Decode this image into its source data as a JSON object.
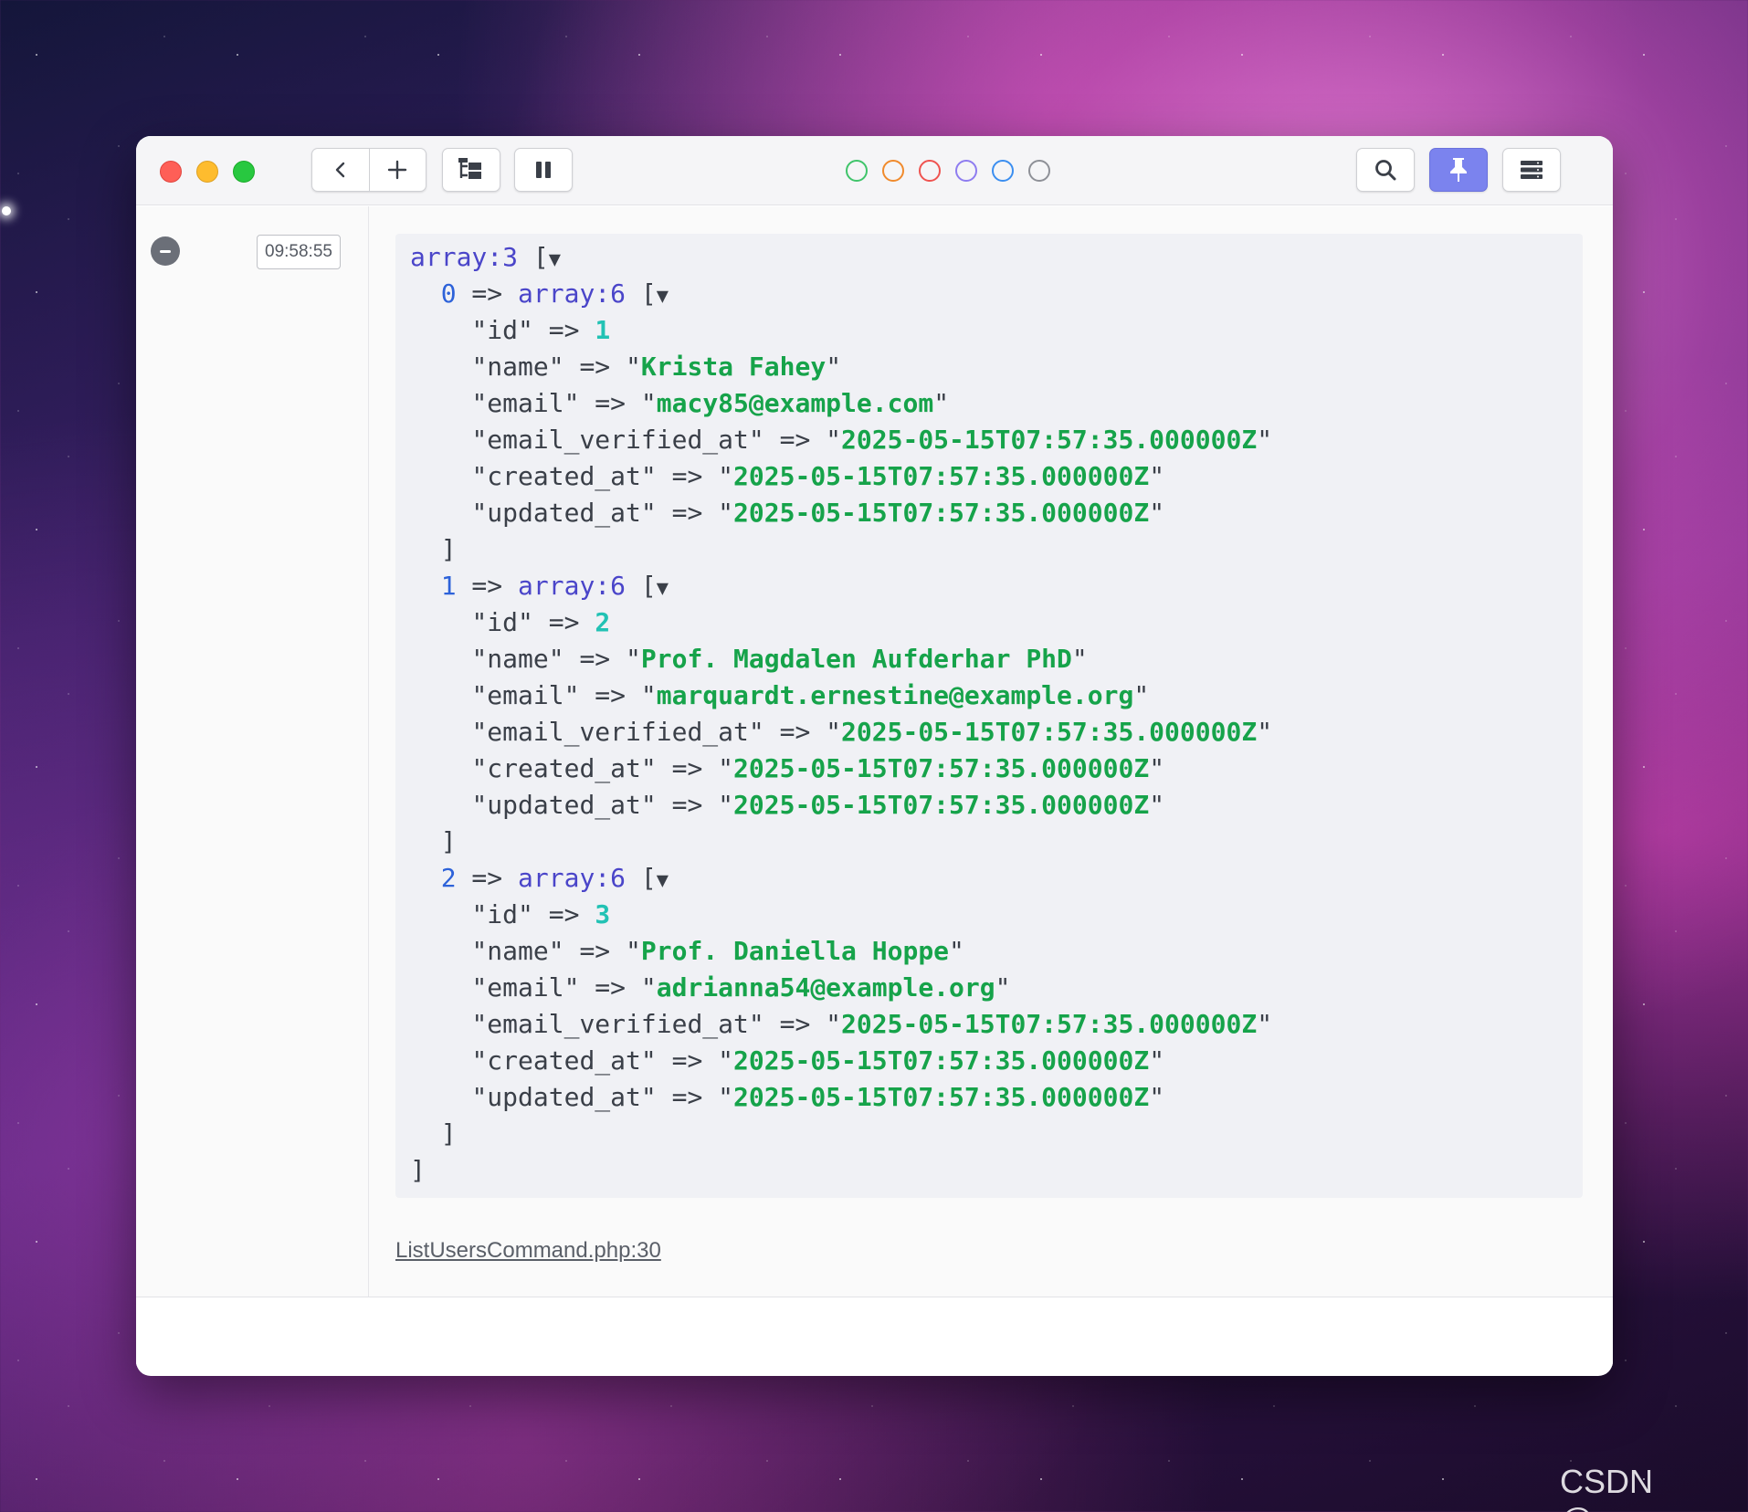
{
  "toolbar": {
    "back_icon": "chevron-left-icon",
    "add_icon": "plus-icon",
    "tree_icon": "tree-view-icon",
    "pause_icon": "pause-icon",
    "search_icon": "search-icon",
    "pin_icon": "pin-icon",
    "menu_icon": "server-stack-icon",
    "accent_color": "#7b83ee"
  },
  "color_filters": [
    {
      "name": "green",
      "color": "#3fc46a"
    },
    {
      "name": "orange",
      "color": "#f08a2c"
    },
    {
      "name": "red",
      "color": "#ef5350"
    },
    {
      "name": "purple",
      "color": "#8e7cf0"
    },
    {
      "name": "blue",
      "color": "#3b8ef0"
    },
    {
      "name": "gray",
      "color": "#8e9097"
    }
  ],
  "entry": {
    "timestamp": "09:58:55",
    "source": "ListUsersCommand.php:30"
  },
  "dump": {
    "root_type": "array:3",
    "items": [
      {
        "index": "0",
        "type": "array:6",
        "fields": [
          {
            "key": "\"id\"",
            "value": "1",
            "kind": "num"
          },
          {
            "key": "\"name\"",
            "value": "Krista Fahey",
            "kind": "str"
          },
          {
            "key": "\"email\"",
            "value": "macy85@example.com",
            "kind": "str"
          },
          {
            "key": "\"email_verified_at\"",
            "value": "2025-05-15T07:57:35.000000Z",
            "kind": "str"
          },
          {
            "key": "\"created_at\"",
            "value": "2025-05-15T07:57:35.000000Z",
            "kind": "str"
          },
          {
            "key": "\"updated_at\"",
            "value": "2025-05-15T07:57:35.000000Z",
            "kind": "str"
          }
        ]
      },
      {
        "index": "1",
        "type": "array:6",
        "fields": [
          {
            "key": "\"id\"",
            "value": "2",
            "kind": "num"
          },
          {
            "key": "\"name\"",
            "value": "Prof. Magdalen Aufderhar PhD",
            "kind": "str"
          },
          {
            "key": "\"email\"",
            "value": "marquardt.ernestine@example.org",
            "kind": "str"
          },
          {
            "key": "\"email_verified_at\"",
            "value": "2025-05-15T07:57:35.000000Z",
            "kind": "str"
          },
          {
            "key": "\"created_at\"",
            "value": "2025-05-15T07:57:35.000000Z",
            "kind": "str"
          },
          {
            "key": "\"updated_at\"",
            "value": "2025-05-15T07:57:35.000000Z",
            "kind": "str"
          }
        ]
      },
      {
        "index": "2",
        "type": "array:6",
        "fields": [
          {
            "key": "\"id\"",
            "value": "3",
            "kind": "num"
          },
          {
            "key": "\"name\"",
            "value": "Prof. Daniella Hoppe",
            "kind": "str"
          },
          {
            "key": "\"email\"",
            "value": "adrianna54@example.org",
            "kind": "str"
          },
          {
            "key": "\"email_verified_at\"",
            "value": "2025-05-15T07:57:35.000000Z",
            "kind": "str"
          },
          {
            "key": "\"created_at\"",
            "value": "2025-05-15T07:57:35.000000Z",
            "kind": "str"
          },
          {
            "key": "\"updated_at\"",
            "value": "2025-05-15T07:57:35.000000Z",
            "kind": "str"
          }
        ]
      }
    ]
  },
  "watermark": "CSDN @rorg"
}
